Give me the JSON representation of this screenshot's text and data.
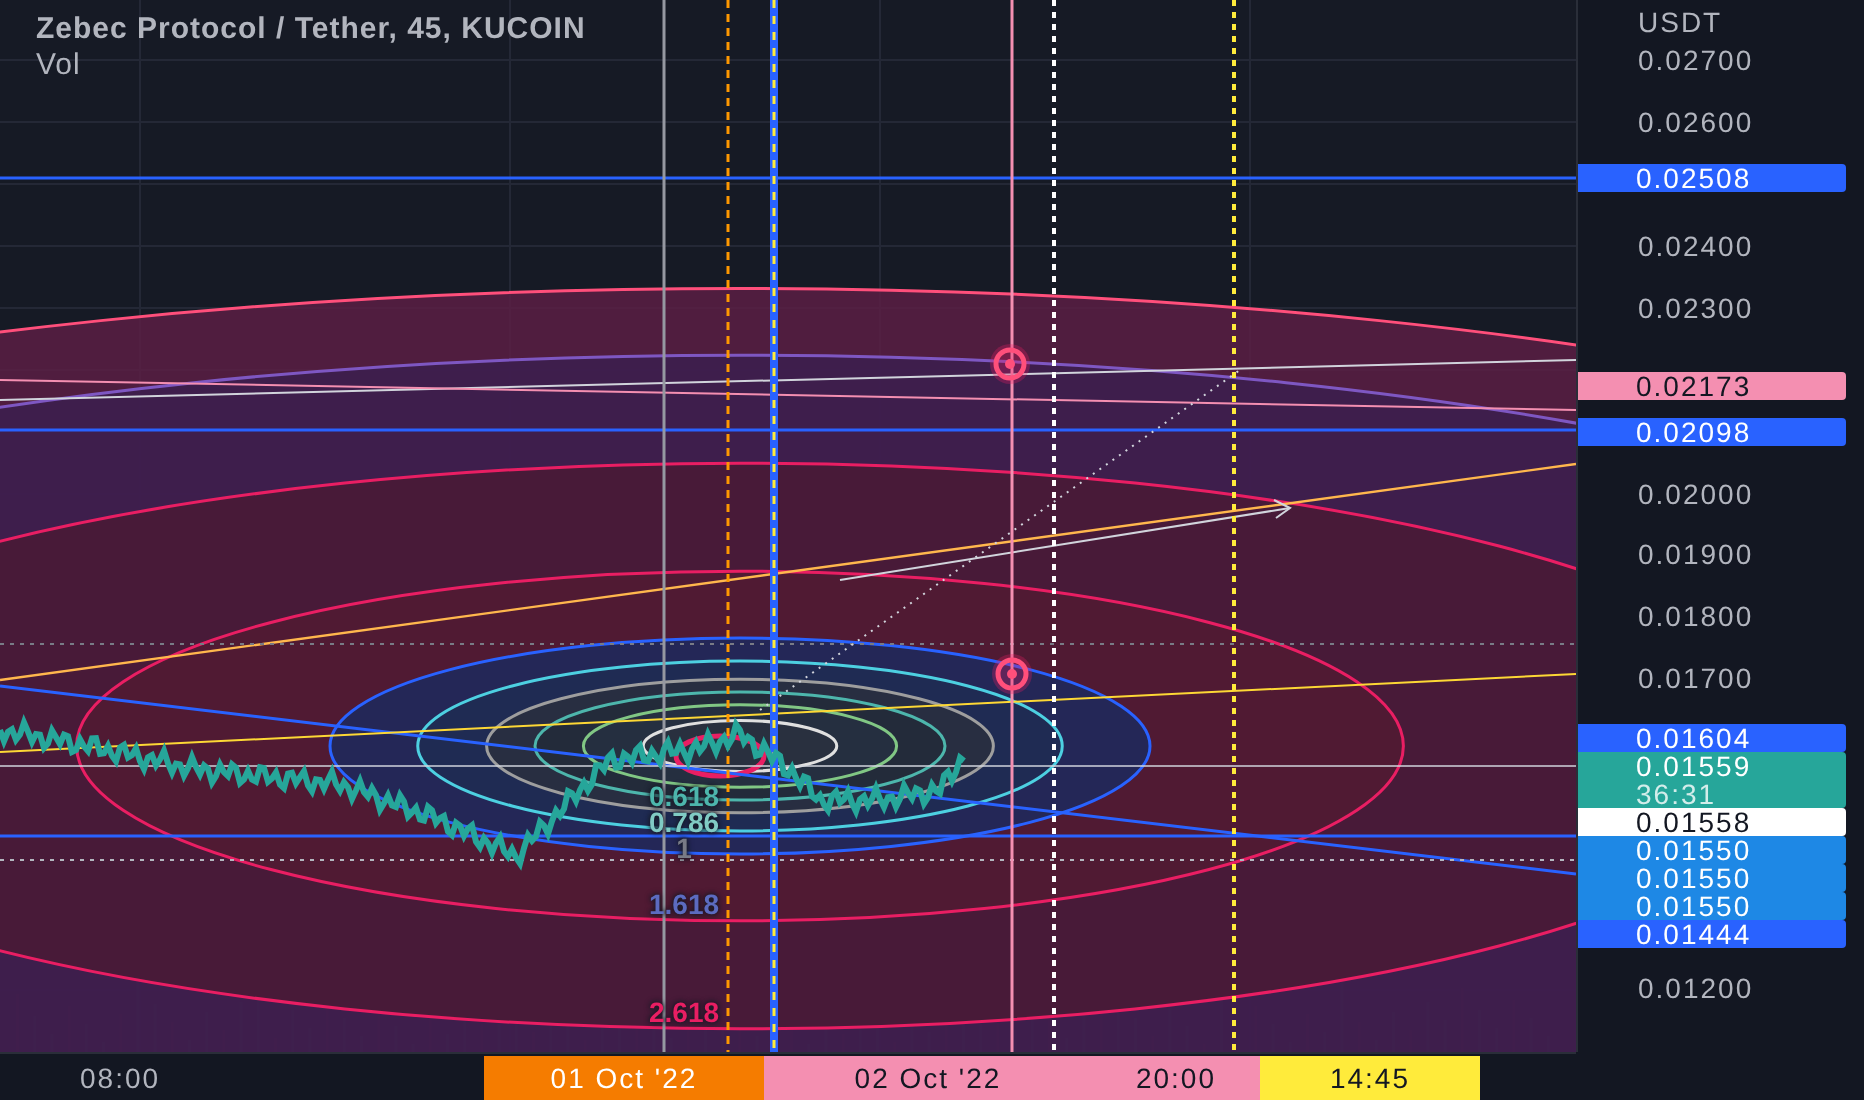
{
  "chart": {
    "legend": {
      "title": "Zebec Protocol / Tether, 45, KUCOIN",
      "indicator": "Vol"
    },
    "fib_labels": [
      {
        "label": "0.618",
        "color": "#4db6ac"
      },
      {
        "label": "0.786",
        "color": "#80cbc4"
      },
      {
        "label": "1",
        "color": "#787b86"
      },
      {
        "label": "1.618",
        "color": "#5c6bc0"
      },
      {
        "label": "2.618",
        "color": "#e91e63"
      }
    ]
  },
  "price_axis": {
    "unit": "USDT",
    "ticks": [
      "0.02700",
      "0.02600",
      "0.02400",
      "0.02300",
      "0.02000",
      "0.01900",
      "0.01800",
      "0.01700",
      "0.01200"
    ],
    "tags": [
      {
        "price": "0.02508",
        "color": "#2962ff"
      },
      {
        "price": "0.02173",
        "color": "#f48fb1"
      },
      {
        "price": "0.02098",
        "color": "#2962ff"
      },
      {
        "price": "0.01604",
        "color": "#2962ff"
      },
      {
        "price": "0.01559",
        "countdown": "36:31",
        "color": "#26a69a"
      },
      {
        "price": "0.01558",
        "color": "#ffffff"
      },
      {
        "price": "0.01550",
        "color": "#1e88e5"
      },
      {
        "price": "0.01550",
        "color": "#1e88e5"
      },
      {
        "price": "0.01550",
        "color": "#1e88e5"
      },
      {
        "price": "0.01444",
        "color": "#2962ff"
      }
    ]
  },
  "time_axis": {
    "ticks": [
      "08:00"
    ],
    "tags": [
      {
        "label": "01 Oct '22",
        "color": "#f57c00"
      },
      {
        "label": "02 Oct '22",
        "color": "#f48fb1"
      },
      {
        "label": "20:00",
        "color": "#f48fb1"
      },
      {
        "label": "14:45",
        "color": "#ffeb3b"
      }
    ]
  }
}
